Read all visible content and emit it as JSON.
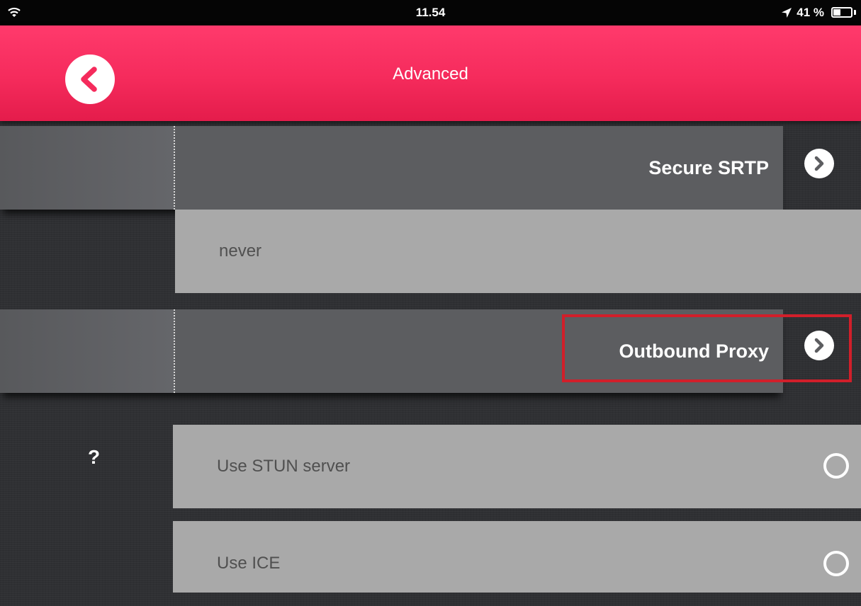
{
  "status_bar": {
    "time": "11.54",
    "battery_percent": "41 %",
    "battery_level": 0.41
  },
  "header": {
    "title": "Advanced",
    "back_icon": "chevron-left-circle-icon",
    "brand_color": "#f52b5c"
  },
  "settings": {
    "secure_srtp": {
      "label": "Secure SRTP",
      "value": "never"
    },
    "outbound_proxy": {
      "label": "Outbound Proxy"
    },
    "help_icon_text": "?",
    "use_stun": {
      "label": "Use STUN server",
      "checked": false
    },
    "use_ice": {
      "label": "Use ICE",
      "checked": false
    }
  },
  "annotation": {
    "highlight_color": "#d11f2a"
  }
}
